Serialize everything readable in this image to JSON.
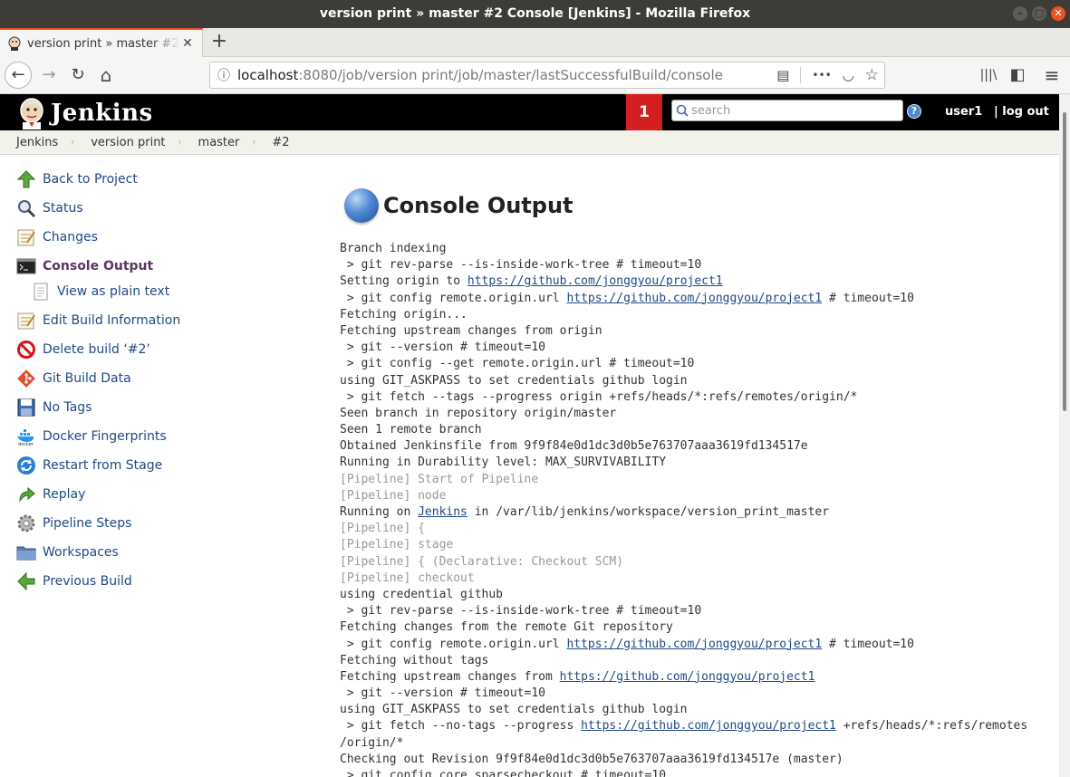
{
  "window": {
    "title": "version print » master #2 Console [Jenkins] - Mozilla Firefox",
    "minimize_glyph": "–",
    "maximize_glyph": "□",
    "close_glyph": "✕"
  },
  "tab": {
    "title": "version print » master #2 Console [Jenkins]",
    "close_glyph": "✕",
    "new_tab_glyph": "+"
  },
  "nav": {
    "url_host": "localhost",
    "url_rest": ":8080/job/version print/job/master/lastSuccessfulBuild/console",
    "back_glyph": "←",
    "forward_glyph": "→",
    "reload_glyph": "↻",
    "home_glyph": "⌂",
    "reader_glyph": "▤",
    "more_glyph": "•••",
    "pocket_glyph": "◡",
    "star_glyph": "☆",
    "library_glyph": "|||\\",
    "sidebar_glyph": "◧",
    "menu_glyph": "≡"
  },
  "header": {
    "brand": "Jenkins",
    "notifications": "1",
    "search_placeholder": "search",
    "help_glyph": "?",
    "user": "user1",
    "logout": "| log out"
  },
  "breadcrumbs": [
    "Jenkins",
    "version print",
    "master",
    "#2"
  ],
  "breadcrumb_sep": "›",
  "sidebar": [
    {
      "label": "Back to Project",
      "icon": "up-arrow-icon"
    },
    {
      "label": "Status",
      "icon": "magnifier-icon"
    },
    {
      "label": "Changes",
      "icon": "notepad-icon"
    },
    {
      "label": "Console Output",
      "icon": "terminal-icon",
      "active": true
    },
    {
      "label": "View as plain text",
      "icon": "document-icon",
      "sub": true
    },
    {
      "label": "Edit Build Information",
      "icon": "notepad-icon"
    },
    {
      "label": "Delete build ‘#2’",
      "icon": "no-entry-icon"
    },
    {
      "label": "Git Build Data",
      "icon": "git-icon"
    },
    {
      "label": "No Tags",
      "icon": "save-icon"
    },
    {
      "label": "Docker Fingerprints",
      "icon": "docker-icon"
    },
    {
      "label": "Restart from Stage",
      "icon": "restart-icon"
    },
    {
      "label": "Replay",
      "icon": "replay-icon"
    },
    {
      "label": "Pipeline Steps",
      "icon": "gear-icon"
    },
    {
      "label": "Workspaces",
      "icon": "folder-icon"
    },
    {
      "label": "Previous Build",
      "icon": "left-arrow-icon"
    }
  ],
  "page_title": "Console Output",
  "console": [
    {
      "text": "Branch indexing"
    },
    {
      "text": " > git rev-parse --is-inside-work-tree # timeout=10"
    },
    {
      "text": "Setting origin to ",
      "link": "https://github.com/jonggyou/project1"
    },
    {
      "text": " > git config remote.origin.url ",
      "link": "https://github.com/jonggyou/project1",
      "after": " # timeout=10"
    },
    {
      "text": "Fetching origin..."
    },
    {
      "text": "Fetching upstream changes from origin"
    },
    {
      "text": " > git --version # timeout=10"
    },
    {
      "text": " > git config --get remote.origin.url # timeout=10"
    },
    {
      "text": "using GIT_ASKPASS to set credentials github login"
    },
    {
      "text": " > git fetch --tags --progress origin +refs/heads/*:refs/remotes/origin/*"
    },
    {
      "text": "Seen branch in repository origin/master"
    },
    {
      "text": "Seen 1 remote branch"
    },
    {
      "text": "Obtained Jenkinsfile from 9f9f84e0d1dc3d0b5e763707aaa3619fd134517e"
    },
    {
      "text": "Running in Durability level: MAX_SURVIVABILITY"
    },
    {
      "text": "[Pipeline] Start of Pipeline",
      "pipe": true
    },
    {
      "text": "[Pipeline] node",
      "pipe": true
    },
    {
      "text": "Running on ",
      "link": "Jenkins",
      "after": " in /var/lib/jenkins/workspace/version_print_master"
    },
    {
      "text": "[Pipeline] {",
      "pipe": true
    },
    {
      "text": "[Pipeline] stage",
      "pipe": true
    },
    {
      "text": "[Pipeline] { (Declarative: Checkout SCM)",
      "pipe": true
    },
    {
      "text": "[Pipeline] checkout",
      "pipe": true
    },
    {
      "text": "using credential github"
    },
    {
      "text": " > git rev-parse --is-inside-work-tree # timeout=10"
    },
    {
      "text": "Fetching changes from the remote Git repository"
    },
    {
      "text": " > git config remote.origin.url ",
      "link": "https://github.com/jonggyou/project1",
      "after": " # timeout=10"
    },
    {
      "text": "Fetching without tags"
    },
    {
      "text": "Fetching upstream changes from ",
      "link": "https://github.com/jonggyou/project1"
    },
    {
      "text": " > git --version # timeout=10"
    },
    {
      "text": "using GIT_ASKPASS to set credentials github login"
    },
    {
      "text": " > git fetch --no-tags --progress ",
      "link": "https://github.com/jonggyou/project1",
      "after": " +refs/heads/*:refs/remotes"
    },
    {
      "text": "/origin/*"
    },
    {
      "text": "Checking out Revision 9f9f84e0d1dc3d0b5e763707aaa3619fd134517e (master)"
    },
    {
      "text": " > git config core.sparsecheckout # timeout=10"
    }
  ],
  "colors": {
    "link": "#204a87",
    "active_task": "#5c3566",
    "notification_bg": "#d21f1f",
    "pipeline_text": "#9a9a9a"
  }
}
